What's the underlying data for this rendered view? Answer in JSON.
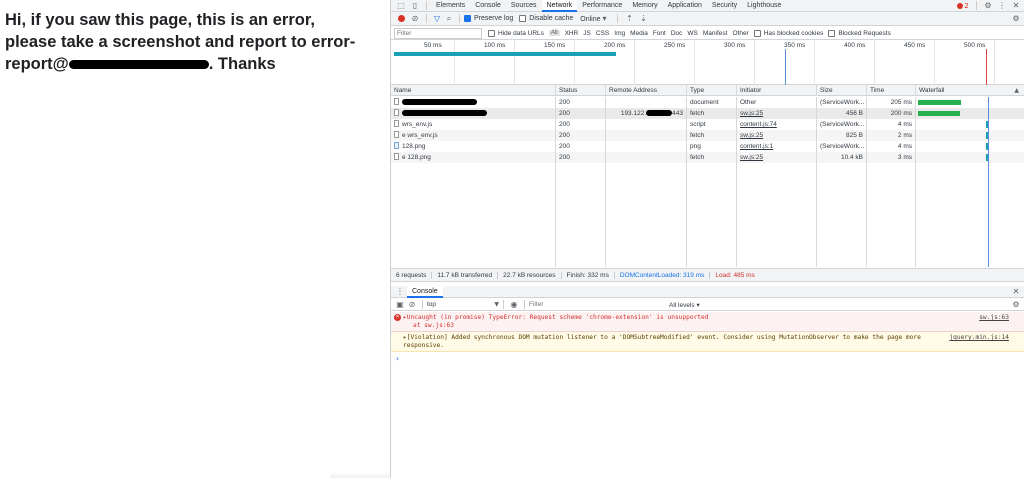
{
  "page": {
    "line1": "Hi, if you saw this page, this is an error,",
    "line2": "please take a screenshot and report to error-",
    "line3_prefix": "report@",
    "line3_suffix": ". Thanks"
  },
  "devtools": {
    "tabs": [
      "Elements",
      "Console",
      "Sources",
      "Network",
      "Performance",
      "Memory",
      "Application",
      "Security",
      "Lighthouse"
    ],
    "active_tab": "Network",
    "error_count": "2",
    "toolbar": {
      "preserve_log": "Preserve log",
      "disable_cache": "Disable cache",
      "throttle": "Online"
    },
    "filterbar": {
      "placeholder": "Filter",
      "hide_data_urls": "Hide data URLs",
      "all_label": "All",
      "types": [
        "XHR",
        "JS",
        "CSS",
        "Img",
        "Media",
        "Font",
        "Doc",
        "WS",
        "Manifest",
        "Other"
      ],
      "has_blocked_cookies": "Has blocked cookies",
      "blocked_requests": "Blocked Requests"
    },
    "overview_ticks": [
      "50 ms",
      "100 ms",
      "150 ms",
      "200 ms",
      "250 ms",
      "300 ms",
      "350 ms",
      "400 ms",
      "450 ms",
      "500 ms"
    ],
    "columns": [
      "Name",
      "Status",
      "Remote Address",
      "Type",
      "Initiator",
      "Size",
      "Time",
      "Waterfall"
    ],
    "requests": [
      {
        "name": "",
        "status": "200",
        "remote": "",
        "type": "document",
        "initiator": "Other",
        "size": "(ServiceWork...",
        "time": "205 ms",
        "wf_ms": 205
      },
      {
        "name": "",
        "status": "200",
        "remote": "193.122.",
        "remote_suffix": "443",
        "type": "fetch",
        "initiator": "sw.js:25",
        "size": "456 B",
        "time": "200 ms",
        "wf_ms": 200
      },
      {
        "name": "wrs_env.js",
        "status": "200",
        "remote": "",
        "type": "script",
        "initiator": "content.js:74",
        "size": "(ServiceWork...",
        "time": "4 ms",
        "wf_ms": 4
      },
      {
        "name": "e wrs_env.js",
        "status": "200",
        "remote": "",
        "type": "fetch",
        "initiator": "sw.js:25",
        "size": "825 B",
        "time": "2 ms",
        "wf_ms": 2
      },
      {
        "name": "128.png",
        "status": "200",
        "remote": "",
        "type": "png",
        "initiator": "content.js:1",
        "size": "(ServiceWork...",
        "time": "4 ms",
        "wf_ms": 4
      },
      {
        "name": "e 128.png",
        "status": "200",
        "remote": "",
        "type": "fetch",
        "initiator": "sw.js:25",
        "size": "10.4 kB",
        "time": "3 ms",
        "wf_ms": 3
      }
    ],
    "summary": {
      "requests": "6 requests",
      "transferred": "11.7 kB transferred",
      "resources": "22.7 kB resources",
      "finish": "Finish: 332 ms",
      "dcl": "DOMContentLoaded: 319 ms",
      "load": "Load: 485 ms"
    },
    "console": {
      "tab_label": "Console",
      "context": "top",
      "filter_placeholder": "Filter",
      "levels": "All levels ▾",
      "messages": [
        {
          "kind": "error",
          "text": "▸Uncaught (in promise) TypeError: Request scheme 'chrome-extension' is unsupported",
          "sub": "at sw.js:63",
          "source": "sw.js:63"
        },
        {
          "kind": "violation",
          "text": "▸[Violation] Added synchronous DOM mutation listener to a 'DOMSubtreeModified' event. Consider using MutationObserver to make the page more",
          "sub": "responsive.",
          "source": "jquery.min.js:14"
        }
      ],
      "prompt": "›"
    }
  },
  "colors": {
    "accent": "#1a73e8",
    "waterfall_green": "#27b04f",
    "overview_bar": "#1aa0b4",
    "error_red": "#d32f2f",
    "dcl_blue": "#1a73e8",
    "load_red": "#d32f2f"
  },
  "icons": [
    "inspect-icon",
    "device-toggle-icon",
    "error-count-icon",
    "gear-icon",
    "kebab-menu-icon",
    "close-icon",
    "record-icon",
    "clear-icon",
    "filter-icon",
    "search-icon",
    "upload-icon",
    "download-icon",
    "eye-icon",
    "sidebar-icon",
    "block-icon"
  ]
}
